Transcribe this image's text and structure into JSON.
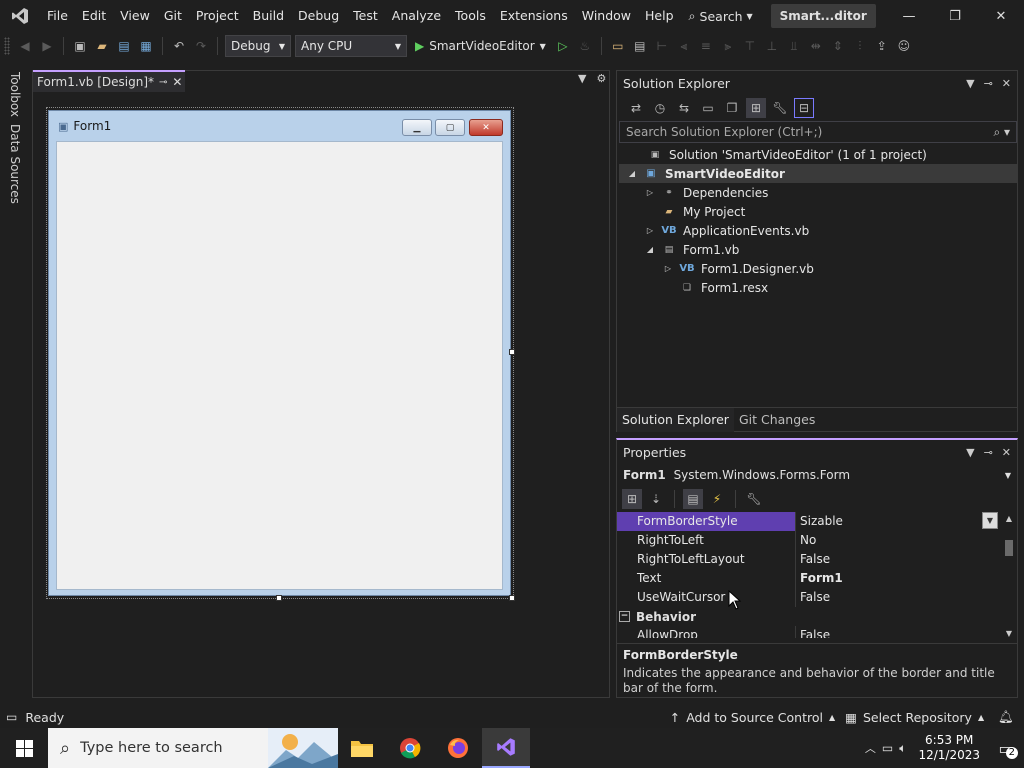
{
  "menubar": {
    "items": [
      "File",
      "Edit",
      "View",
      "Git",
      "Project",
      "Build",
      "Debug",
      "Test",
      "Analyze",
      "Tools",
      "Extensions",
      "Window",
      "Help"
    ],
    "search_label": "Search",
    "solution_title": "Smart...ditor",
    "win_minimize": "—",
    "win_restore": "❐",
    "win_close": "✕"
  },
  "toolbar": {
    "config": "Debug",
    "platform": "Any CPU",
    "start_target": "SmartVideoEditor"
  },
  "left_strip": {
    "toolbox": "Toolbox",
    "data_sources": "Data Sources"
  },
  "document": {
    "tab_label": "Form1.vb [Design]*"
  },
  "form": {
    "title": "Form1"
  },
  "solution_explorer": {
    "title": "Solution Explorer",
    "search_placeholder": "Search Solution Explorer (Ctrl+;)",
    "tree": [
      {
        "label": "Solution 'SmartVideoEditor' (1 of 1 project)",
        "icon": "solution-icon",
        "level": 0
      },
      {
        "label": "SmartVideoEditor",
        "icon": "vb-project-icon",
        "level": 1
      },
      {
        "label": "Dependencies",
        "icon": "dependencies-icon",
        "level": 2
      },
      {
        "label": "My Project",
        "icon": "folder-icon",
        "level": 2
      },
      {
        "label": "ApplicationEvents.vb",
        "icon": "vb-file-icon",
        "level": 2
      },
      {
        "label": "Form1.vb",
        "icon": "form-icon",
        "level": 2
      },
      {
        "label": "Form1.Designer.vb",
        "icon": "vb-file-icon",
        "level": 3
      },
      {
        "label": "Form1.resx",
        "icon": "resx-icon",
        "level": 3
      }
    ],
    "bottom_tabs": [
      "Solution Explorer",
      "Git Changes"
    ]
  },
  "properties": {
    "title": "Properties",
    "object_name": "Form1",
    "object_type": "System.Windows.Forms.Form",
    "rows": [
      {
        "name": "FormBorderStyle",
        "value": "Sizable"
      },
      {
        "name": "RightToLeft",
        "value": "No"
      },
      {
        "name": "RightToLeftLayout",
        "value": "False"
      },
      {
        "name": "Text",
        "value": "Form1"
      },
      {
        "name": "UseWaitCursor",
        "value": "False"
      }
    ],
    "category": "Behavior",
    "partial_row": {
      "name": "AllowDrop",
      "value": "False"
    },
    "desc_title": "FormBorderStyle",
    "desc_text": "Indicates the appearance and behavior of the border and title bar of the form."
  },
  "statusbar": {
    "ready": "Ready",
    "source_control": "Add to Source Control",
    "repository": "Select Repository"
  },
  "taskbar": {
    "search_placeholder": "Type here to search",
    "time": "6:53 PM",
    "date": "12/1/2023",
    "notification_count": "2"
  },
  "colors": {
    "accent": "#c5a0ff",
    "selection": "#5f3fb0",
    "background": "#1f1f1f"
  }
}
